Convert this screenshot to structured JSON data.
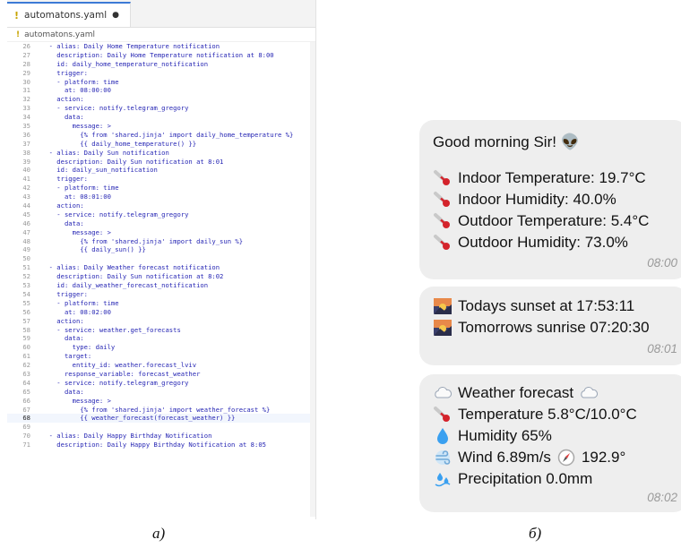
{
  "editor": {
    "tab_title": "automatons.yaml",
    "tab_dirty_marker": "●",
    "file_icon": "!",
    "breadcrumb": "automatons.yaml",
    "lines": [
      {
        "n": "26",
        "t": "  - alias: Daily Home Temperature notification"
      },
      {
        "n": "27",
        "t": "    description: Daily Home Temperature notification at 8:00"
      },
      {
        "n": "28",
        "t": "    id: daily_home_temperature_notification"
      },
      {
        "n": "29",
        "t": "    trigger:"
      },
      {
        "n": "30",
        "t": "    - platform: time"
      },
      {
        "n": "31",
        "t": "      at: 08:00:00"
      },
      {
        "n": "32",
        "t": "    action:"
      },
      {
        "n": "33",
        "t": "    - service: notify.telegram_gregory"
      },
      {
        "n": "34",
        "t": "      data:"
      },
      {
        "n": "35",
        "t": "        message: >"
      },
      {
        "n": "36",
        "t": "          {% from 'shared.jinja' import daily_home_temperature %}"
      },
      {
        "n": "37",
        "t": "          {{ daily_home_temperature() }}"
      },
      {
        "n": "38",
        "t": "  - alias: Daily Sun notification"
      },
      {
        "n": "39",
        "t": "    description: Daily Sun notification at 8:01"
      },
      {
        "n": "40",
        "t": "    id: daily_sun_notification"
      },
      {
        "n": "41",
        "t": "    trigger:"
      },
      {
        "n": "42",
        "t": "    - platform: time"
      },
      {
        "n": "43",
        "t": "      at: 08:01:00"
      },
      {
        "n": "44",
        "t": "    action:"
      },
      {
        "n": "45",
        "t": "    - service: notify.telegram_gregory"
      },
      {
        "n": "46",
        "t": "      data:"
      },
      {
        "n": "47",
        "t": "        message: >"
      },
      {
        "n": "48",
        "t": "          {% from 'shared.jinja' import daily_sun %}"
      },
      {
        "n": "49",
        "t": "          {{ daily_sun() }}"
      },
      {
        "n": "50",
        "t": ""
      },
      {
        "n": "51",
        "t": "  - alias: Daily Weather forecast notification"
      },
      {
        "n": "52",
        "t": "    description: Daily Sun notification at 8:02"
      },
      {
        "n": "53",
        "t": "    id: daily_weather_forecast_notification"
      },
      {
        "n": "54",
        "t": "    trigger:"
      },
      {
        "n": "55",
        "t": "    - platform: time"
      },
      {
        "n": "56",
        "t": "      at: 08:02:00"
      },
      {
        "n": "57",
        "t": "    action:"
      },
      {
        "n": "58",
        "t": "    - service: weather.get_forecasts"
      },
      {
        "n": "59",
        "t": "      data:"
      },
      {
        "n": "60",
        "t": "        type: daily"
      },
      {
        "n": "61",
        "t": "      target:"
      },
      {
        "n": "62",
        "t": "        entity_id: weather.forecast_lviv"
      },
      {
        "n": "63",
        "t": "      response_variable: forecast_weather"
      },
      {
        "n": "64",
        "t": "    - service: notify.telegram_gregory"
      },
      {
        "n": "65",
        "t": "      data:"
      },
      {
        "n": "66",
        "t": "        message: >"
      },
      {
        "n": "67",
        "t": "          {% from 'shared.jinja' import weather_forecast %}"
      },
      {
        "n": "68",
        "t": "          {{ weather_forecast(forecast_weather) }}"
      },
      {
        "n": "69",
        "t": ""
      },
      {
        "n": "70",
        "t": "  - alias: Daily Happy Birthday Notification"
      },
      {
        "n": "71",
        "t": "    description: Daily Happy Birthday Notification at 8:05"
      }
    ],
    "cursor_line": "68",
    "code_color": "#2626b4"
  },
  "chat": {
    "message1": {
      "greeting": "Good morning Sir! 👽",
      "rows": [
        {
          "icon": "thermometer-icon",
          "text": "Indoor Temperature: 19.7°C"
        },
        {
          "icon": "thermometer-icon",
          "text": "Indoor Humidity: 40.0%"
        },
        {
          "icon": "thermometer-icon",
          "text": "Outdoor Temperature: 5.4°C"
        },
        {
          "icon": "thermometer-icon",
          "text": "Outdoor Humidity: 73.0%"
        }
      ],
      "time": "08:00"
    },
    "message2": {
      "rows": [
        {
          "icon": "sunset-icon",
          "text": "Todays sunset at 17:53:11"
        },
        {
          "icon": "sunset-icon",
          "text": "Tomorrows sunrise 07:20:30"
        }
      ],
      "time": "08:01"
    },
    "message3": {
      "rows": [
        {
          "icon": "cloud-icon",
          "text": "Weather forecast"
        },
        {
          "icon": "thermometer-icon",
          "text": "Temperature 5.8°C/10.0°C"
        },
        {
          "icon": "droplet-icon",
          "text": "Humidity 65%"
        },
        {
          "icon": "wind-icon",
          "text": "Wind 6.89m/s"
        },
        {
          "icon": "splash-icon",
          "text": "Precipitation 0.0mm"
        }
      ],
      "wind_direction": "192.9°",
      "time": "08:02"
    },
    "bubble_color": "#eeeeee"
  },
  "captions": {
    "left": "a)",
    "right": "б)"
  }
}
